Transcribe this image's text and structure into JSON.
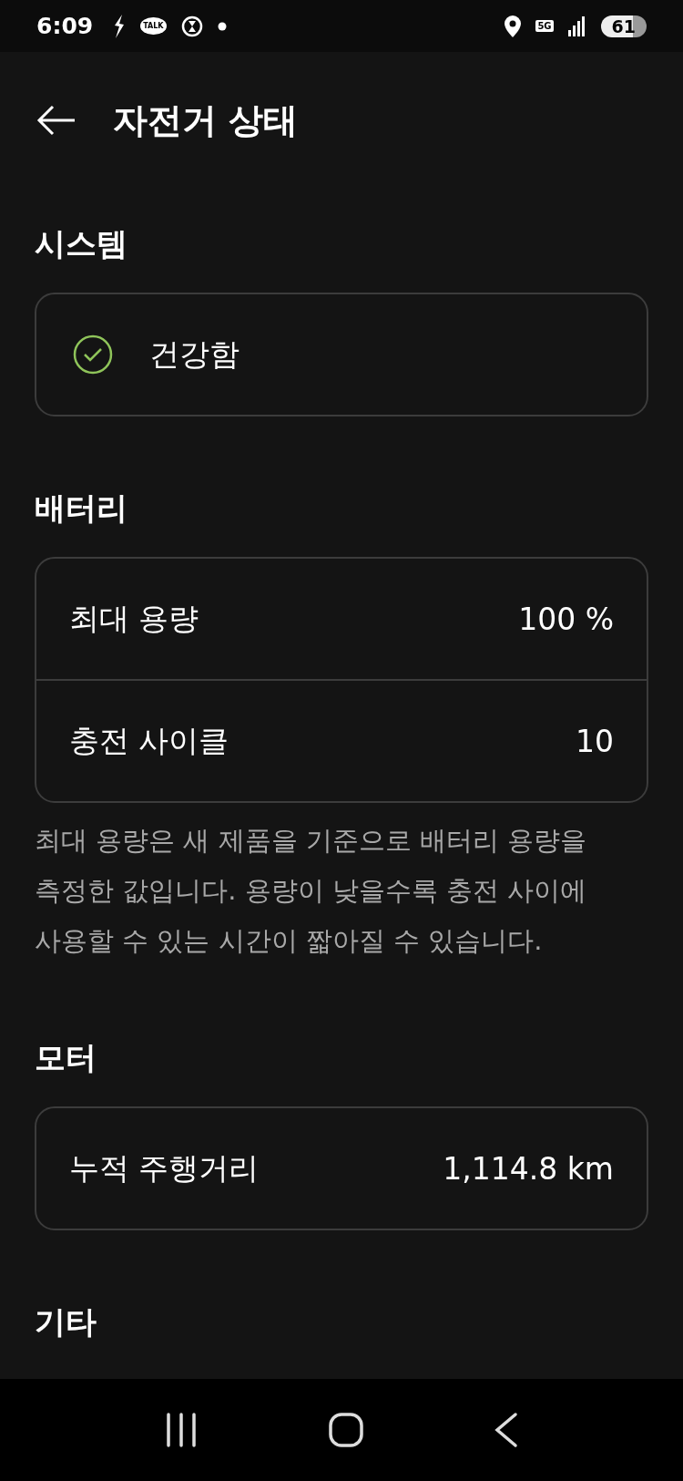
{
  "status_bar": {
    "time": "6:09",
    "talk_badge": "TALK",
    "network": "5G",
    "battery": "61"
  },
  "header": {
    "title": "자전거 상태"
  },
  "sections": [
    {
      "heading": "시스템",
      "kind": "status",
      "rows": [
        {
          "label": "건강함"
        }
      ]
    },
    {
      "heading": "배터리",
      "kind": "values",
      "rows": [
        {
          "label": "최대 용량",
          "value": "100 %"
        },
        {
          "label": "충전 사이클",
          "value": "10"
        }
      ],
      "note": "최대 용량은 새 제품을 기준으로 배터리 용량을 측정한 값입니다. 용량이 낮을수록 충전 사이에 사용할 수 있는 시간이 짧아질 수 있습니다."
    },
    {
      "heading": "모터",
      "kind": "values",
      "rows": [
        {
          "label": "누적 주행거리",
          "value": "1,114.8 km"
        }
      ]
    },
    {
      "heading": "기타"
    }
  ]
}
